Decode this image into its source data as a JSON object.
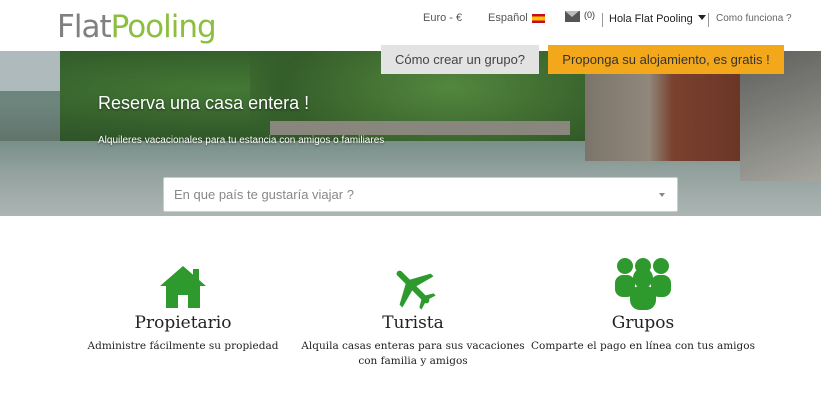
{
  "header": {
    "logo_part1": "Flat",
    "logo_part2": "Pooling",
    "currency": "Euro - €",
    "language": "Español",
    "messages_count": "(0)",
    "user_greeting": "Hola Flat Pooling",
    "help_link": "Como funciona ?"
  },
  "hero": {
    "create_group_button": "Cómo crear un grupo?",
    "propose_button": "Proponga su alojamiento, es gratis !",
    "title": "Reserva una casa entera !",
    "subtitle": "Alquileres vacacionales para tu estancia con amigos o familiares",
    "search_placeholder": "En que país te gustaría viajar ?"
  },
  "features": [
    {
      "title": "Propietario",
      "description": "Administre fácilmente su propiedad",
      "icon": "home-icon"
    },
    {
      "title": "Turista",
      "description": "Alquila casas enteras para sus vacaciones con familia y amigos",
      "icon": "airplane-icon"
    },
    {
      "title": "Grupos",
      "description": "Comparte el pago en línea con tus amigos",
      "icon": "group-icon"
    }
  ],
  "colors": {
    "brand_green": "#8cbf3f",
    "icon_green": "#2e9a2e",
    "accent_orange": "#f3a81b"
  }
}
